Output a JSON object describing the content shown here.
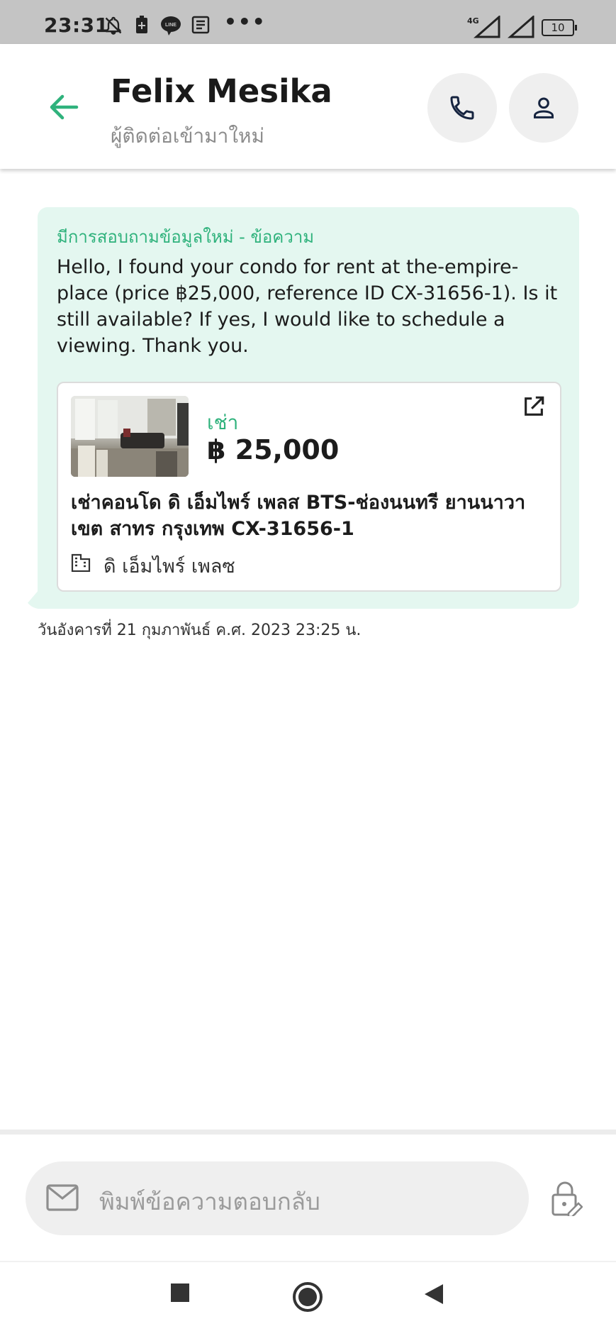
{
  "status_bar": {
    "time": "23:31",
    "icons": [
      "bell-off-icon",
      "battery-saver-icon",
      "line-app-icon",
      "news-icon"
    ],
    "more": "•••",
    "network": "4G",
    "battery": "10"
  },
  "header": {
    "contact_name": "Felix Mesika",
    "subtitle": "ผู้ติดต่อเข้ามาใหม่",
    "actions": [
      "phone-icon",
      "person-icon"
    ]
  },
  "message": {
    "tag": "มีการสอบถามข้อมูลใหม่ - ข้อความ",
    "body": "Hello, I found your condo for rent at the-empire-place (price ฿25,000, reference ID CX-31656-1). Is it still available? If yes, I would like to schedule a viewing. Thank you.",
    "listing": {
      "type": "เช่า",
      "price": "฿ 25,000",
      "title": "เช่าคอนโด  ดิ เอ็มไพร์ เพลส BTS-ช่องนนทรี ยานนาวา เขต สาทร กรุงเทพ CX-31656-1",
      "project": "ดิ เอ็มไพร์ เพลซ"
    },
    "timestamp": "วันอังคารที่ 21 กุมภาพันธ์ ค.ศ. 2023 23:25 น."
  },
  "reply": {
    "placeholder": "พิมพ์ข้อความตอบกลับ"
  },
  "colors": {
    "accent": "#2fb27c",
    "bubble": "#e4f7f0",
    "status_bar": "#c4c4c4"
  }
}
